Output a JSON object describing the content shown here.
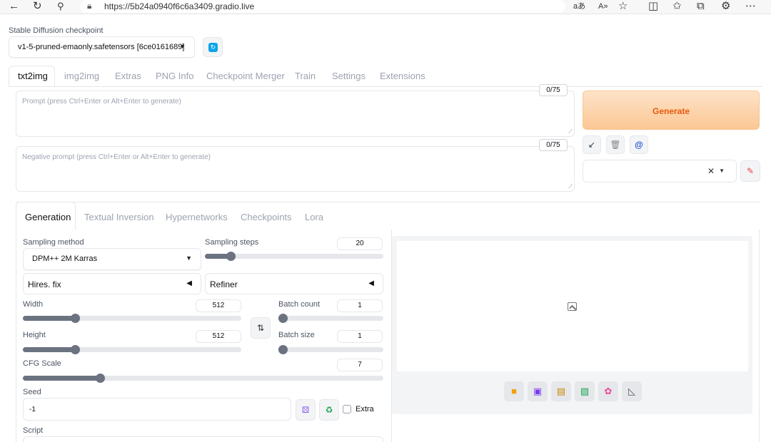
{
  "browser": {
    "url": "https://5b24a0940f6c6a3409.gradio.live",
    "icons": [
      "back-icon",
      "reload-icon",
      "search-icon",
      "site-info-icon",
      "read-aloud-icon",
      "text-size-icon",
      "favorite-icon",
      "split-screen-icon",
      "favorites-icon",
      "collections-icon",
      "extensions-icon",
      "more-icon"
    ]
  },
  "checkpoint": {
    "label": "Stable Diffusion checkpoint",
    "value": "v1-5-pruned-emaonly.safetensors [6ce0161689]"
  },
  "tabs": [
    "txt2img",
    "img2img",
    "Extras",
    "PNG Info",
    "Checkpoint Merger",
    "Train",
    "Settings",
    "Extensions"
  ],
  "prompt": {
    "placeholder": "Prompt (press Ctrl+Enter or Alt+Enter to generate)",
    "counter": "0/75"
  },
  "negative_prompt": {
    "placeholder": "Negative prompt (press Ctrl+Enter or Alt+Enter to generate)",
    "counter": "0/75"
  },
  "generate_label": "Generate",
  "inner_tabs": [
    "Generation",
    "Textual Inversion",
    "Hypernetworks",
    "Checkpoints",
    "Lora"
  ],
  "sampling": {
    "method_label": "Sampling method",
    "method_value": "DPM++ 2M Karras",
    "steps_label": "Sampling steps",
    "steps_value": "20"
  },
  "accordions": {
    "hires": "Hires. fix",
    "refiner": "Refiner"
  },
  "dimensions": {
    "width_label": "Width",
    "width_value": "512",
    "height_label": "Height",
    "height_value": "512",
    "batch_count_label": "Batch count",
    "batch_count_value": "1",
    "batch_size_label": "Batch size",
    "batch_size_value": "1"
  },
  "cfg": {
    "label": "CFG Scale",
    "value": "7"
  },
  "seed": {
    "label": "Seed",
    "value": "-1",
    "extra_label": "Extra"
  },
  "script_label": "Script",
  "colors": {
    "generate_text": "#ea580c",
    "accent_blue": "#0ea5e9",
    "slider": "#6b7280"
  }
}
